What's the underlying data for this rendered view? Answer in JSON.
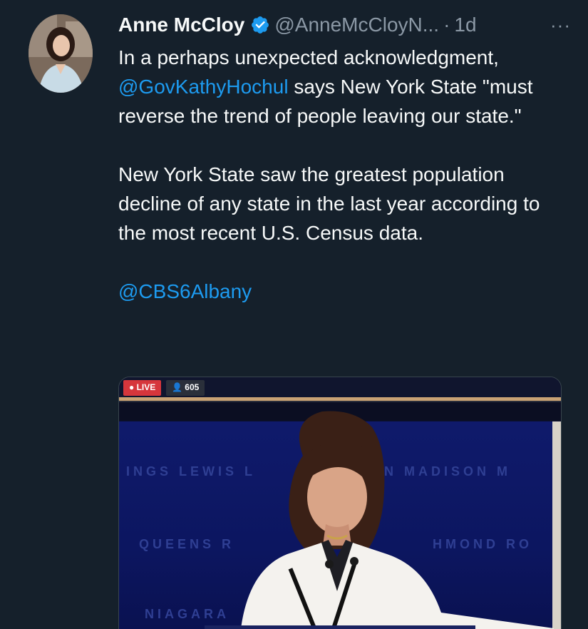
{
  "author": {
    "display_name": "Anne McCloy",
    "handle": "@AnneMcCloyN...",
    "separator": "·",
    "time": "1d",
    "more_label": "···"
  },
  "tweet": {
    "p1_text": "In a perhaps unexpected acknowledgment,",
    "p1_mention": "@GovKathyHochul",
    "p1_rest": " says New York State \"must reverse the trend of people leaving our state.\"",
    "p2": "New York State saw the greatest population decline of any state in the last year according to the most recent U.S. Census data.",
    "p3_mention": "@CBS6Albany"
  },
  "media": {
    "live_label": "LIVE",
    "viewer_count": "605",
    "wall_row1": "INGS  LEWIS  L",
    "wall_row1b": "N  MADISON  M",
    "wall_row2": "QUEENS  R",
    "wall_row2b": "HMOND  RO",
    "wall_row3": "NIAGARA"
  },
  "colors": {
    "background": "#15202b",
    "link": "#1d9bf0",
    "verified": "#1d9bf0",
    "muted": "#8b98a5"
  },
  "icons": {
    "verified": "verified-badge-icon",
    "more": "more-horizontal-icon",
    "viewer": "person-icon"
  }
}
